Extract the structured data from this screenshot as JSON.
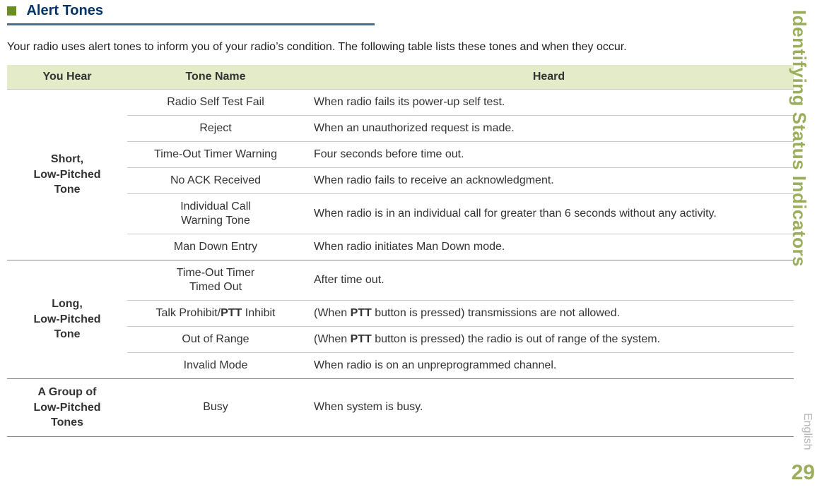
{
  "section": {
    "title": "Alert Tones",
    "intro": "Your radio uses alert tones to inform you of your radio’s condition. The following table lists these tones and when they occur."
  },
  "table": {
    "headers": {
      "you_hear": "You Hear",
      "tone_name": "Tone Name",
      "heard": "Heard"
    },
    "group_short": {
      "label_l1": "Short,",
      "label_l2": "Low-Pitched",
      "label_l3": "Tone",
      "rows": [
        {
          "name": "Radio Self Test Fail",
          "heard": "When radio fails its power-up self test."
        },
        {
          "name": "Reject",
          "heard": "When an unauthorized request is made."
        },
        {
          "name": "Time-Out Timer Warning",
          "heard": "Four seconds before time out."
        },
        {
          "name": "No ACK Received",
          "heard": "When radio fails to receive an acknowledgment."
        },
        {
          "name_l1": "Individual Call",
          "name_l2": "Warning Tone",
          "heard": "When radio is in an individual call for greater than 6 seconds without any activity."
        },
        {
          "name": "Man Down Entry",
          "heard": "When radio initiates Man Down mode."
        }
      ]
    },
    "group_long": {
      "label_l1": "Long,",
      "label_l2": "Low-Pitched",
      "label_l3": "Tone",
      "rows": [
        {
          "name_l1": "Time-Out Timer",
          "name_l2": "Timed Out",
          "heard": "After time out."
        },
        {
          "name_pre": "Talk Prohibit/",
          "name_bold": "PTT",
          "name_post": " Inhibit",
          "heard_pre": "(When ",
          "heard_bold": "PTT",
          "heard_post": " button is pressed) transmissions are not allowed."
        },
        {
          "name": "Out of Range",
          "heard_pre": "(When ",
          "heard_bold": "PTT",
          "heard_post": " button is pressed) the radio is out of range of the system."
        },
        {
          "name": "Invalid Mode",
          "heard": "When radio is on an unpreprogrammed channel."
        }
      ]
    },
    "group_busy": {
      "label_l1": "A Group of",
      "label_l2": "Low-Pitched",
      "label_l3": "Tones",
      "row": {
        "name": "Busy",
        "heard": "When system is busy."
      }
    }
  },
  "side": {
    "chapter": "Identifying Status Indicators",
    "page": "29",
    "lang": "English"
  }
}
